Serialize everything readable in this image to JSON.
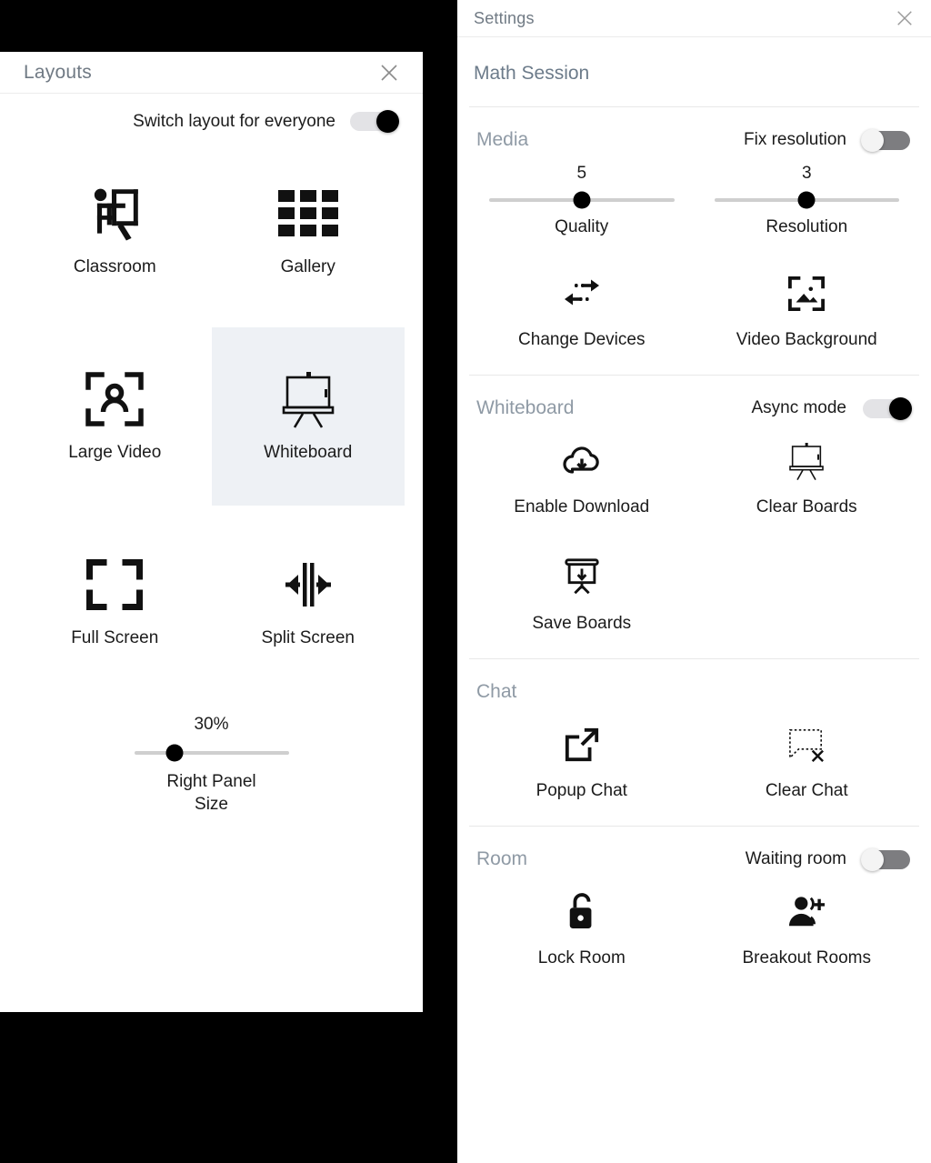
{
  "layouts_panel": {
    "title": "Layouts",
    "close_icon": "close-icon",
    "switch_everyone": {
      "label": "Switch layout for everyone",
      "state": "on"
    },
    "tiles": [
      {
        "label": "Classroom",
        "icon": "classroom-icon",
        "selected": false
      },
      {
        "label": "Gallery",
        "icon": "grid-icon",
        "selected": false
      },
      {
        "label": "Large Video",
        "icon": "person-frame-icon",
        "selected": false
      },
      {
        "label": "Whiteboard",
        "icon": "easel-icon",
        "selected": true
      },
      {
        "label": "Full Screen",
        "icon": "fullscreen-icon",
        "selected": false
      },
      {
        "label": "Split Screen",
        "icon": "split-screen-icon",
        "selected": false
      }
    ],
    "right_panel_size": {
      "value": "30%",
      "caption": "Right Panel Size",
      "percent": 26
    }
  },
  "settings_panel": {
    "title": "Settings",
    "close_icon": "close-icon",
    "session_name": "Math Session",
    "sections": [
      {
        "title": "Media",
        "toggle": {
          "label": "Fix resolution",
          "state": "off"
        },
        "sliders": [
          {
            "value": "5",
            "caption": "Quality",
            "percent": 50
          },
          {
            "value": "3",
            "caption": "Resolution",
            "percent": 50
          }
        ],
        "cells": [
          {
            "label": "Change Devices",
            "icon": "swap-arrows-icon"
          },
          {
            "label": "Video Background",
            "icon": "image-frame-icon"
          }
        ]
      },
      {
        "title": "Whiteboard",
        "toggle": {
          "label": "Async mode",
          "state": "on"
        },
        "cells": [
          {
            "label": "Enable Download",
            "icon": "cloud-download-icon"
          },
          {
            "label": "Clear Boards",
            "icon": "easel-icon"
          },
          {
            "label": "Save Boards",
            "icon": "board-download-icon"
          }
        ]
      },
      {
        "title": "Chat",
        "cells": [
          {
            "label": "Popup Chat",
            "icon": "open-in-new-icon"
          },
          {
            "label": "Clear Chat",
            "icon": "speech-bubble-x-icon"
          }
        ]
      },
      {
        "title": "Room",
        "toggle": {
          "label": "Waiting room",
          "state": "off"
        },
        "cells": [
          {
            "label": "Lock Room",
            "icon": "unlocked-padlock-icon"
          },
          {
            "label": "Breakout Rooms",
            "icon": "person-plus-icon"
          }
        ]
      }
    ]
  },
  "colors": {
    "selected_tile_bg": "#eef1f5",
    "section_title": "#8f9aa5",
    "panel_title": "#707a84",
    "toggle_on_knob": "#000000",
    "toggle_off_track": "#7d7d80",
    "backdrop": "#000000"
  }
}
